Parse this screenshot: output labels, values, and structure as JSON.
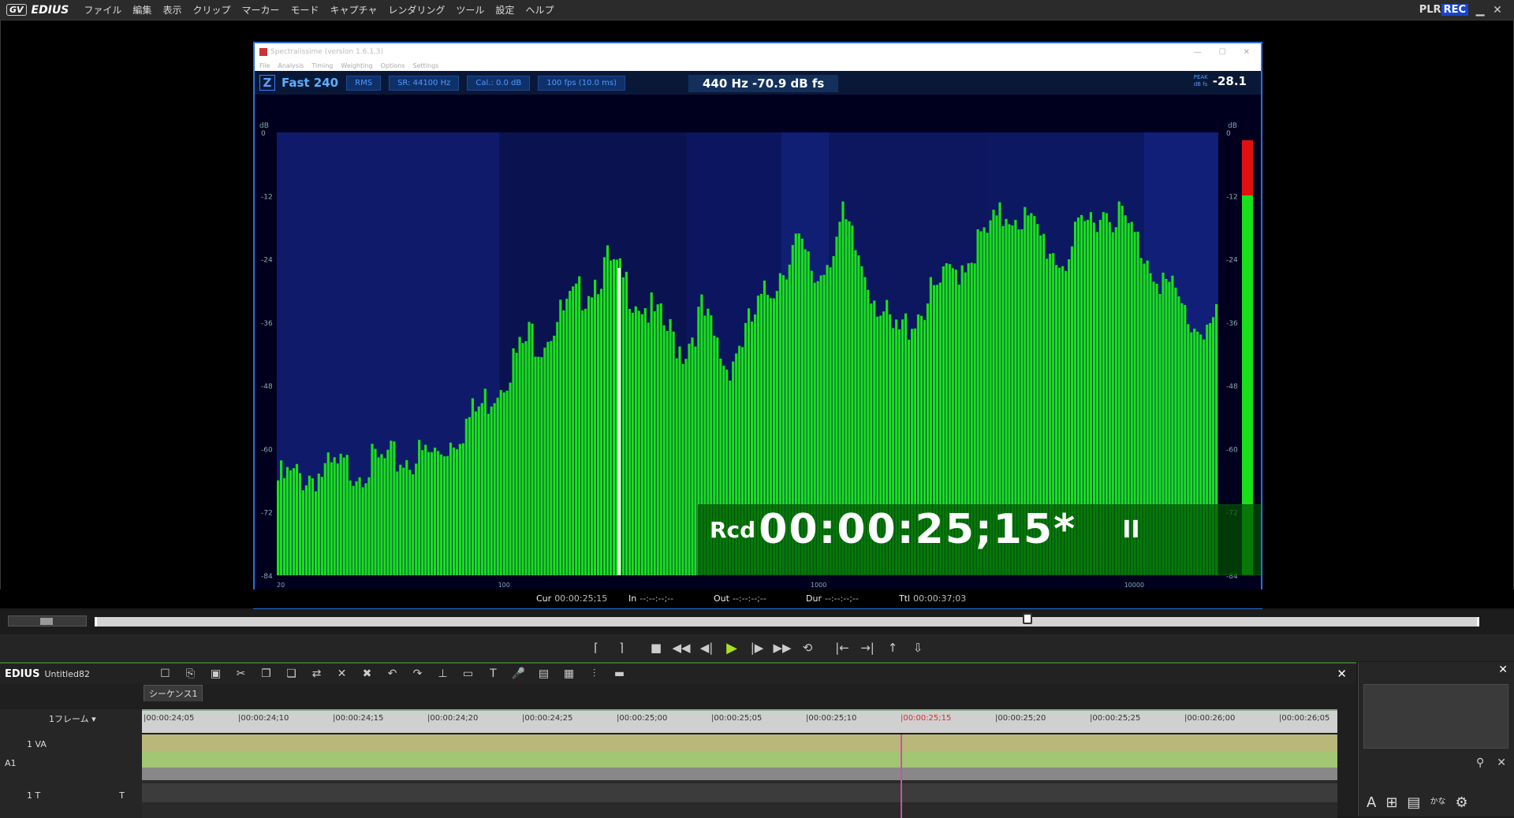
{
  "app": {
    "name": "EDIUS",
    "logo_mark": "GV"
  },
  "menu": [
    "ファイル",
    "編集",
    "表示",
    "クリップ",
    "マーカー",
    "モード",
    "キャプチャ",
    "レンダリング",
    "ツール",
    "設定",
    "ヘルプ"
  ],
  "window_right": {
    "plr": "PLR",
    "rec": "REC"
  },
  "analyzer": {
    "title": "Spectralissime (version 1.6.1.3)",
    "menu": [
      "File",
      "Analysis",
      "Timing",
      "Weighting",
      "Options",
      "Settings"
    ],
    "z": "Z",
    "mode": "Fast 240",
    "rms": "RMS",
    "sr": "SR: 44100 Hz",
    "cal": "Cal.: 0.0 dB",
    "fps": "100 fps (10.0 ms)",
    "readout": "440 Hz   -70.9 dB fs",
    "peak_label_1": "PEAK",
    "peak_label_2": "dB fs",
    "peak_value": "-28.1",
    "db_unit": "dB",
    "db_ticks": [
      "0",
      "-12",
      "-24",
      "-36",
      "-48",
      "-60",
      "-72",
      "-84"
    ],
    "freq_ticks": [
      "20",
      "100",
      "1000",
      "10000"
    ]
  },
  "overlay": {
    "rcd": "Rcd",
    "timecode": "00:00:25;15*",
    "pause": "II"
  },
  "status": {
    "cur_label": "Cur",
    "cur": "00:00:25;15",
    "in_label": "In",
    "in": "--:--:--;--",
    "out_label": "Out",
    "out": "--:--:--;--",
    "dur_label": "Dur",
    "dur": "--:--:--;--",
    "ttl_label": "Ttl",
    "ttl": "00:00:37;03"
  },
  "seek": {
    "position": 0.67
  },
  "timeline": {
    "app": "EDIUS",
    "project": "Untitled82",
    "sequence_tab": "シーケンス1",
    "scale": "1フレーム",
    "ruler": [
      "00:00:24;05",
      "00:00:24;10",
      "00:00:24;15",
      "00:00:24;20",
      "00:00:24;25",
      "00:00:25;00",
      "00:00:25;05",
      "00:00:25;10",
      "00:00:25;15",
      "00:00:25;20",
      "00:00:25;25",
      "00:00:26;00",
      "00:00:26;05"
    ],
    "current_index": 8,
    "track_va": "1 VA",
    "track_a": "A",
    "track_a_num": "1",
    "track_t": "1 T"
  },
  "side_labels": {
    "kana": "かな"
  },
  "colors": {
    "accent": "#2c6fe0",
    "spectrum": "#19e019",
    "meter_red": "#e01010"
  }
}
